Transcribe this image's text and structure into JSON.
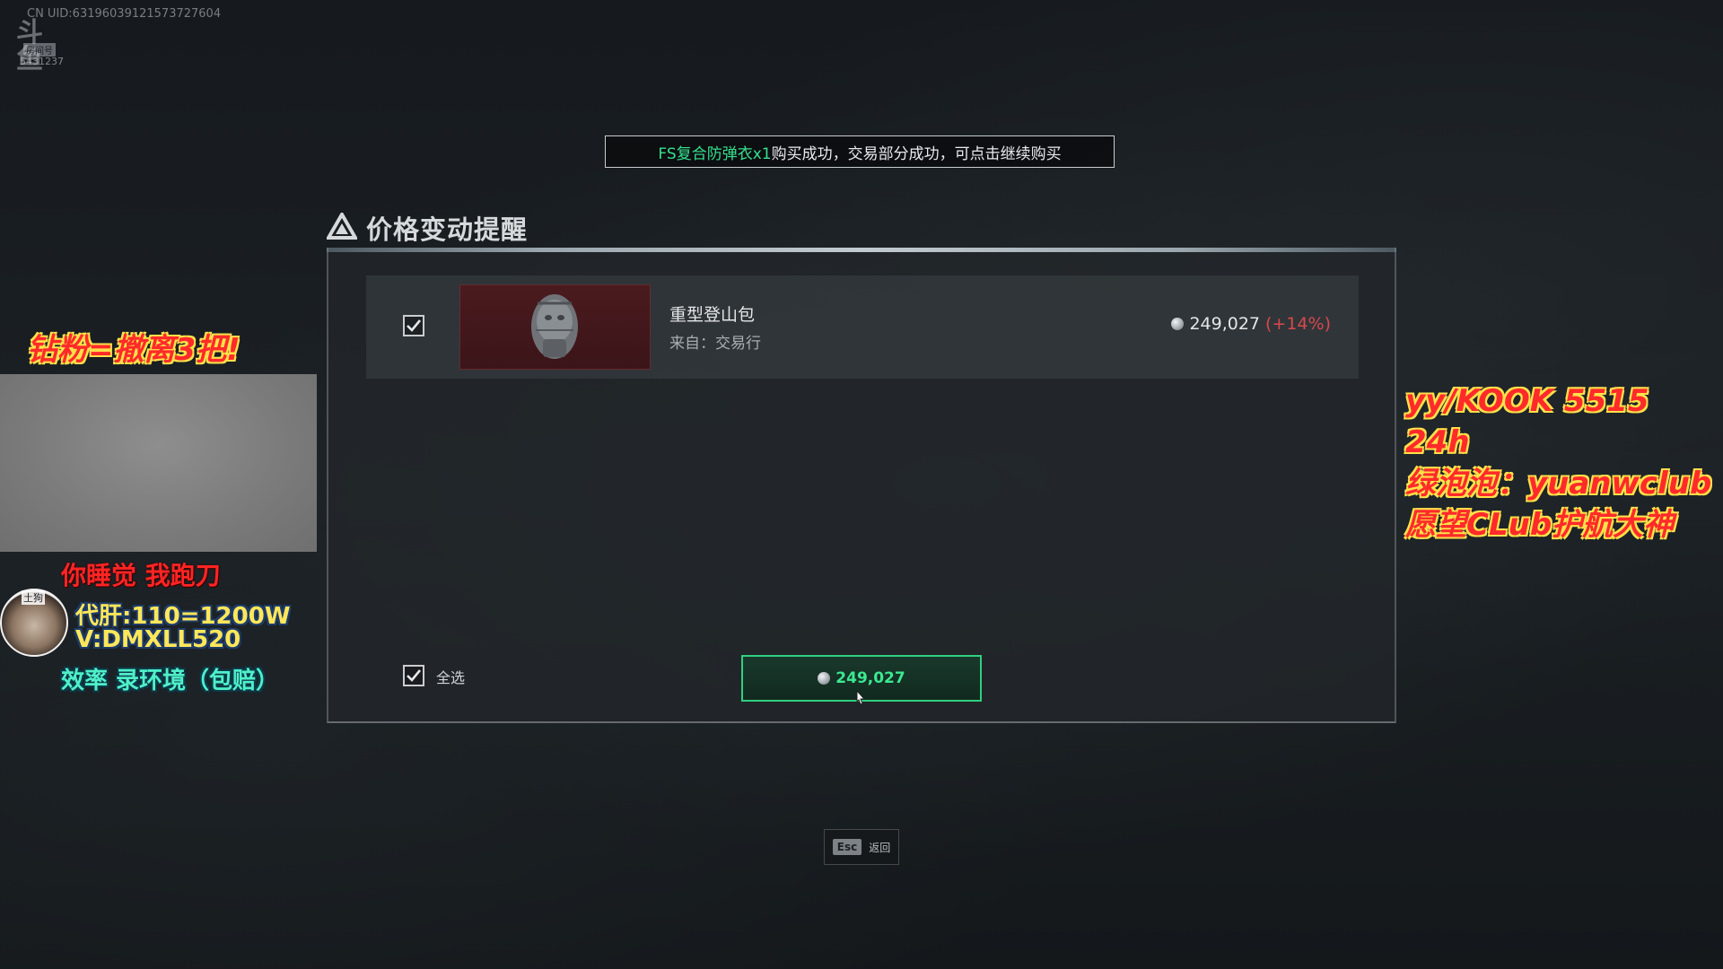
{
  "watermark": {
    "uid": "CN UID:631960391215737276​04",
    "logo_text": "斗鱼",
    "logo_sub": "房间号",
    "room_id": "5431237"
  },
  "banner": {
    "item_highlight": "FS复合防弹衣x1",
    "message": "购买成功，交易部分成功，可点击继续购买"
  },
  "dialog": {
    "title": "价格变动提醒",
    "items": [
      {
        "checked": true,
        "name": "重型登山包",
        "source": "来自：交易行",
        "price": "249,027",
        "change": "(+14%)"
      }
    ],
    "select_all": {
      "checked": true,
      "label": "全选"
    },
    "buy_button": {
      "amount": "249,027"
    },
    "esc": {
      "key": "Esc",
      "label": "返回"
    }
  },
  "overlays": {
    "left_top": "钻粉=撤离3把!",
    "sleep_line": "你睡觉 我跑刀",
    "avatar_tag": "土狗",
    "service_line_1": "代肝:110=1200W",
    "service_line_2": "V:DMXLL520",
    "efficiency_line": "效率 录环境（包赔）",
    "right_lines": [
      "yy/KOOK 5515 24h",
      "绿泡泡：yuanwclub",
      "愿望CLub护航大神"
    ]
  },
  "colors": {
    "accent_green": "#2fd07f",
    "price_up_red": "#d8484c",
    "banner_highlight": "#35e08e"
  }
}
